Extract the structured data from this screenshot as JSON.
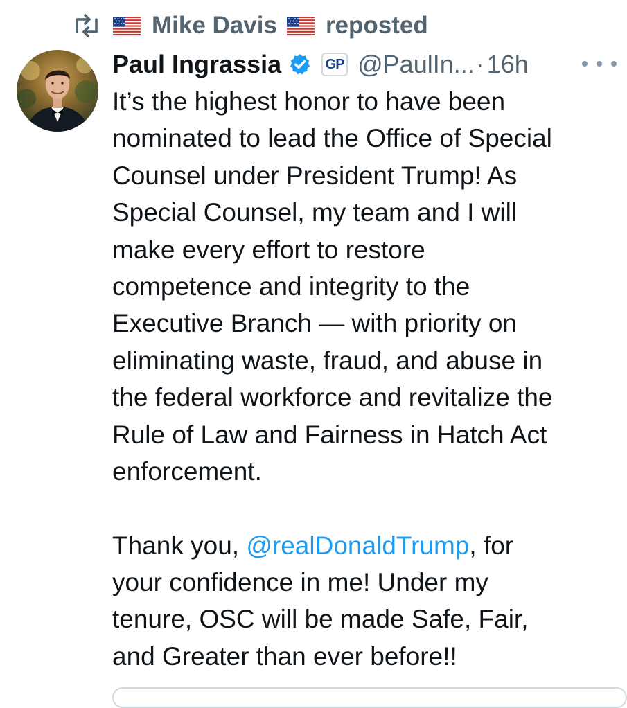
{
  "repost_banner": {
    "user": "Mike Davis",
    "action": "reposted",
    "flag_icon": "us-flag-icon"
  },
  "tweet": {
    "author_name": "Paul Ingrassia",
    "handle": "@PaulIn...",
    "separator": "·",
    "time": "16h",
    "badge_text": "GP",
    "paragraph1_lines": [
      "It’s the highest honor to have been",
      "nominated to lead the Office of Special",
      "Counsel under President Trump! As",
      "Special Counsel, my team and I will",
      "make every effort to restore",
      "competence and integrity to the",
      "Executive Branch — with priority on",
      "eliminating waste, fraud, and abuse in",
      "the federal workforce and revitalize the",
      "Rule of Law and Fairness in Hatch Act",
      "enforcement."
    ],
    "p2_line1_prefix": "Thank you, ",
    "mention": "@realDonaldTrump",
    "p2_line1_suffix": ", for",
    "p2_line2": "your confidence in me! Under my",
    "p2_line3": "tenure, OSC will be made Safe, Fair,",
    "p2_line4": "and Greater than ever before!!"
  },
  "colors": {
    "text": "#0f1419",
    "secondary": "#536471",
    "link": "#1d9bf0",
    "verified": "#1d9bf0"
  }
}
